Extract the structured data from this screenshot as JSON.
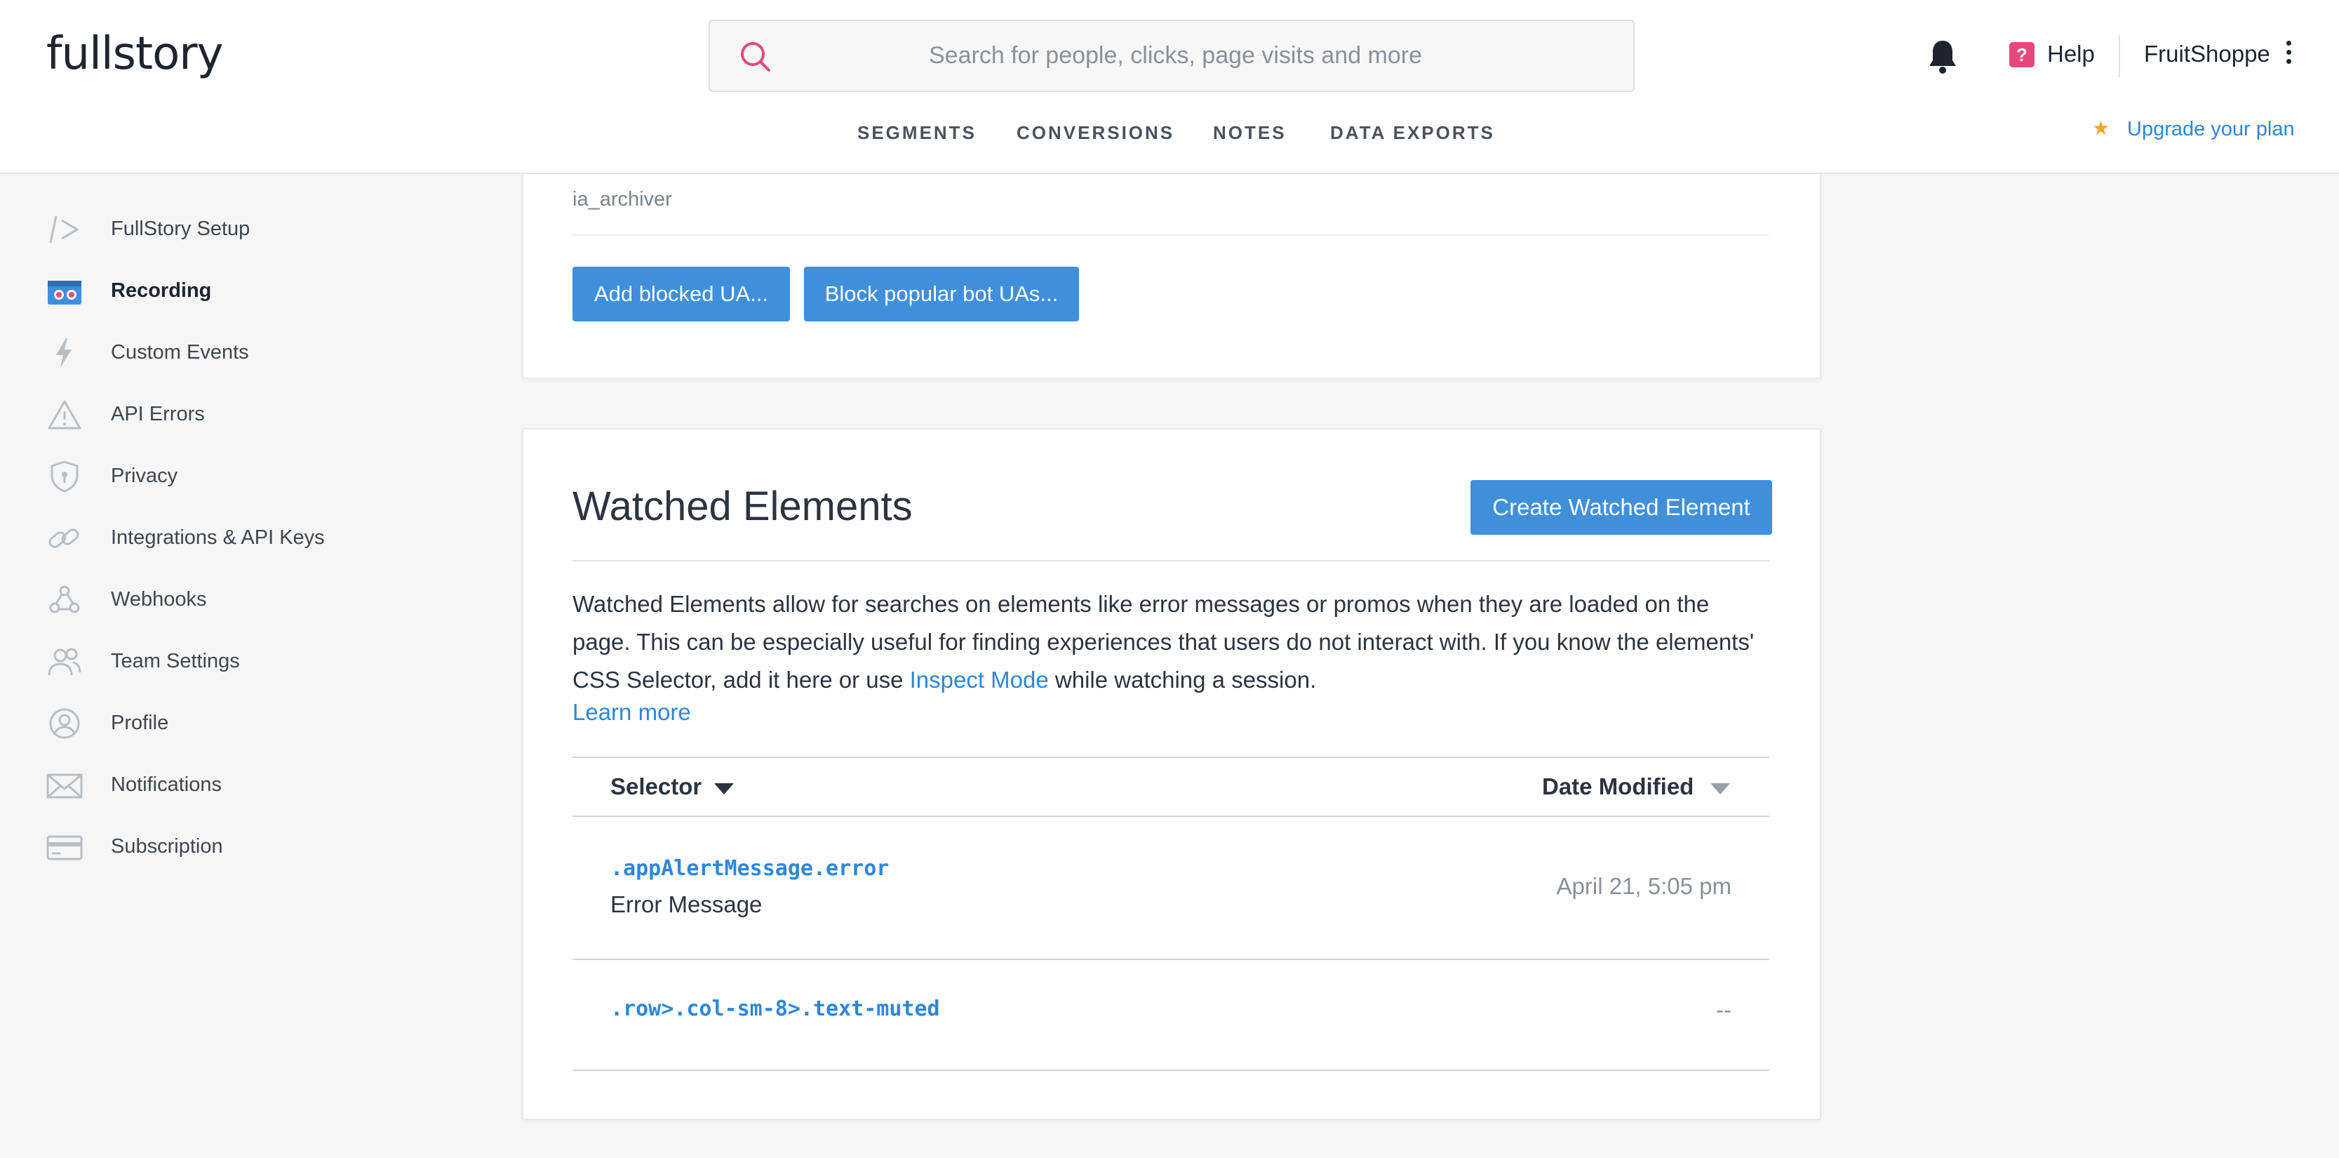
{
  "header": {
    "logo": "fullstory",
    "search_placeholder": "Search for people, clicks, page visits and more",
    "help_badge": "?",
    "help_label": "Help",
    "org_name": "FruitShoppe",
    "upgrade_label": "Upgrade your plan",
    "nav": [
      "SEGMENTS",
      "CONVERSIONS",
      "NOTES",
      "DATA EXPORTS"
    ]
  },
  "sidebar": {
    "items": [
      {
        "label": "FullStory Setup",
        "icon": "code-icon",
        "active": false
      },
      {
        "label": "Recording",
        "icon": "recording-icon",
        "active": true
      },
      {
        "label": "Custom Events",
        "icon": "lightning-icon",
        "active": false
      },
      {
        "label": "API Errors",
        "icon": "warning-icon",
        "active": false
      },
      {
        "label": "Privacy",
        "icon": "shield-icon",
        "active": false
      },
      {
        "label": "Integrations & API Keys",
        "icon": "link-icon",
        "active": false
      },
      {
        "label": "Webhooks",
        "icon": "webhook-icon",
        "active": false
      },
      {
        "label": "Team Settings",
        "icon": "team-icon",
        "active": false
      },
      {
        "label": "Profile",
        "icon": "profile-icon",
        "active": false
      },
      {
        "label": "Notifications",
        "icon": "envelope-icon",
        "active": false
      },
      {
        "label": "Subscription",
        "icon": "card-icon",
        "active": false
      }
    ]
  },
  "blocked_ua": {
    "last_entry": "ia_archiver",
    "add_button": "Add blocked UA...",
    "block_popular_button": "Block popular bot UAs..."
  },
  "watched_elements": {
    "title": "Watched Elements",
    "create_button": "Create Watched Element",
    "desc_before": "Watched Elements allow for searches on elements like error messages or promos when they are loaded on the page. This can be especially useful for finding experiences that users do not interact with. If you know the elements' CSS Selector, add it here or use ",
    "desc_link": "Inspect Mode",
    "desc_after": " while watching a session.",
    "learn_more": "Learn more",
    "columns": {
      "selector": "Selector",
      "date": "Date Modified"
    },
    "rows": [
      {
        "selector": ".appAlertMessage.error",
        "name": "Error Message",
        "date": "April 21, 5:05 pm"
      },
      {
        "selector": ".row>.col-sm-8>.text-muted",
        "name": "",
        "date": "--"
      }
    ]
  },
  "colors": {
    "accent": "#3f8fdb",
    "link": "#2d87d9",
    "help_badge": "#e8477e",
    "star": "#f5a623"
  }
}
